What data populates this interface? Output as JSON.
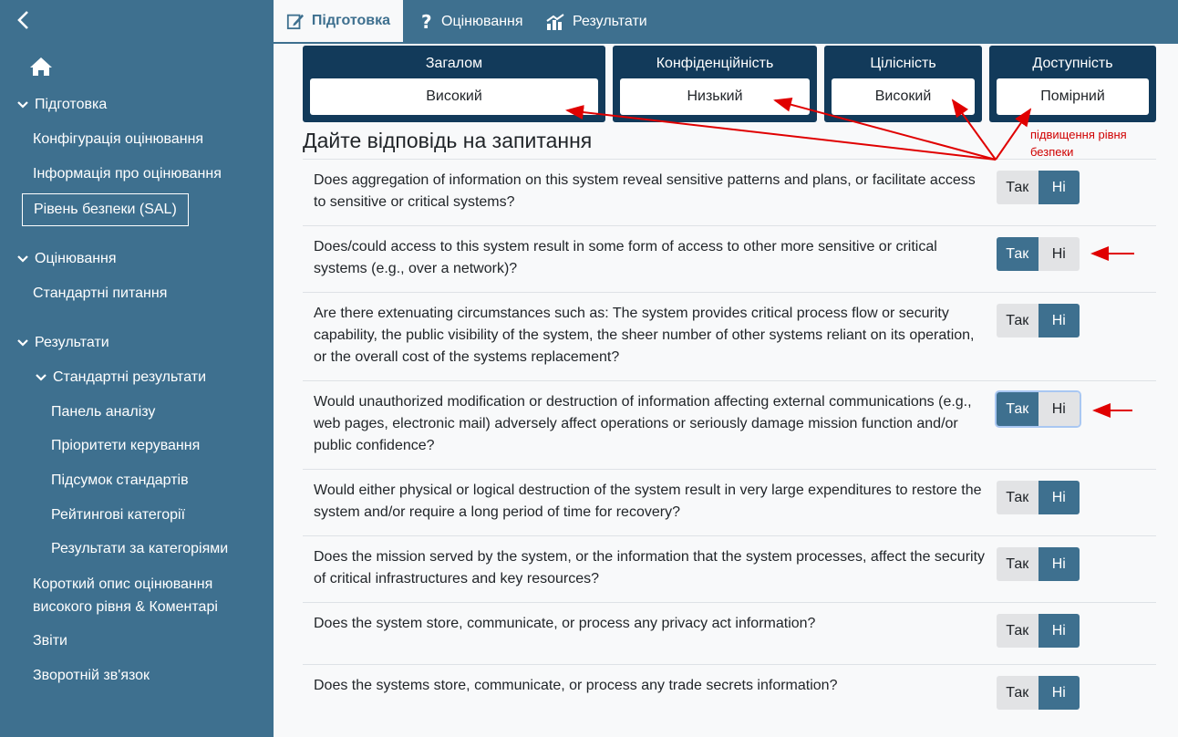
{
  "sidebar": {
    "back_icon": "chevron-left-icon",
    "home_icon": "home-icon",
    "sections": {
      "prep": "Підготовка",
      "prep_items": [
        "Конфігурація оцінювання",
        "Інформація про оцінювання",
        "Рівень безпеки (SAL)"
      ],
      "assessment": "Оцінювання",
      "assessment_items": [
        "Стандартні питання"
      ],
      "results": "Результати",
      "standard_results": "Стандартні результати",
      "standard_results_items": [
        "Панель аналізу",
        "Пріоритети керування",
        "Підсумок стандартів",
        "Рейтингові категорії",
        "Результати за категоріями"
      ],
      "other_items": [
        "Короткий опис оцінювання високого рівня & Коментарі",
        "Звіти",
        "Зворотній зв'язок"
      ]
    }
  },
  "topbar": {
    "tabs": [
      {
        "label": "Підготовка",
        "icon": "edit-icon"
      },
      {
        "label": "Оцінювання",
        "icon": "question-icon"
      },
      {
        "label": "Результати",
        "icon": "chart-icon"
      }
    ]
  },
  "sal": {
    "cards": [
      {
        "title": "Загалом",
        "value": "Високий"
      },
      {
        "title": "Конфіденційність",
        "value": "Низький"
      },
      {
        "title": "Цілісність",
        "value": "Високий"
      },
      {
        "title": "Доступність",
        "value": "Помірний"
      }
    ]
  },
  "main": {
    "heading": "Дайте відповідь на запитання",
    "annotation_note": "підвищення рівня безпеки",
    "yes_label": "Так",
    "no_label": "Ні",
    "questions": [
      {
        "text": "Does aggregation of information on this system reveal sensitive patterns and plans, or facilitate access to sensitive or critical systems?",
        "answer": "no"
      },
      {
        "text": "Does/could access to this system result in some form of access to other more sensitive or critical systems (e.g., over a network)?",
        "answer": "yes"
      },
      {
        "text": "Are there extenuating circumstances such as: The system provides critical process flow or security capability, the public visibility of the system, the sheer number of other systems reliant on its operation, or the overall cost of the systems replacement?",
        "answer": "no"
      },
      {
        "text": "Would unauthorized modification or destruction of information affecting external communications (e.g., web pages, electronic mail) adversely affect operations or seriously damage mission function and/or public confidence?",
        "answer": "yes"
      },
      {
        "text": "Would either physical or logical destruction of the system result in very large expenditures to restore the system and/or require a long period of time for recovery?",
        "answer": "no"
      },
      {
        "text": "Does the mission served by the system, or the information that the system processes, affect the security of critical infrastructures and key resources?",
        "answer": "no"
      },
      {
        "text": "Does the system store, communicate, or process any privacy act information?",
        "answer": "no"
      },
      {
        "text": "Does the systems store, communicate, or process any trade secrets information?",
        "answer": "no"
      }
    ]
  },
  "colors": {
    "sidebar": "#3e708f",
    "card": "#123a5a",
    "accent": "#3e708f",
    "annotation": "#d00000"
  }
}
